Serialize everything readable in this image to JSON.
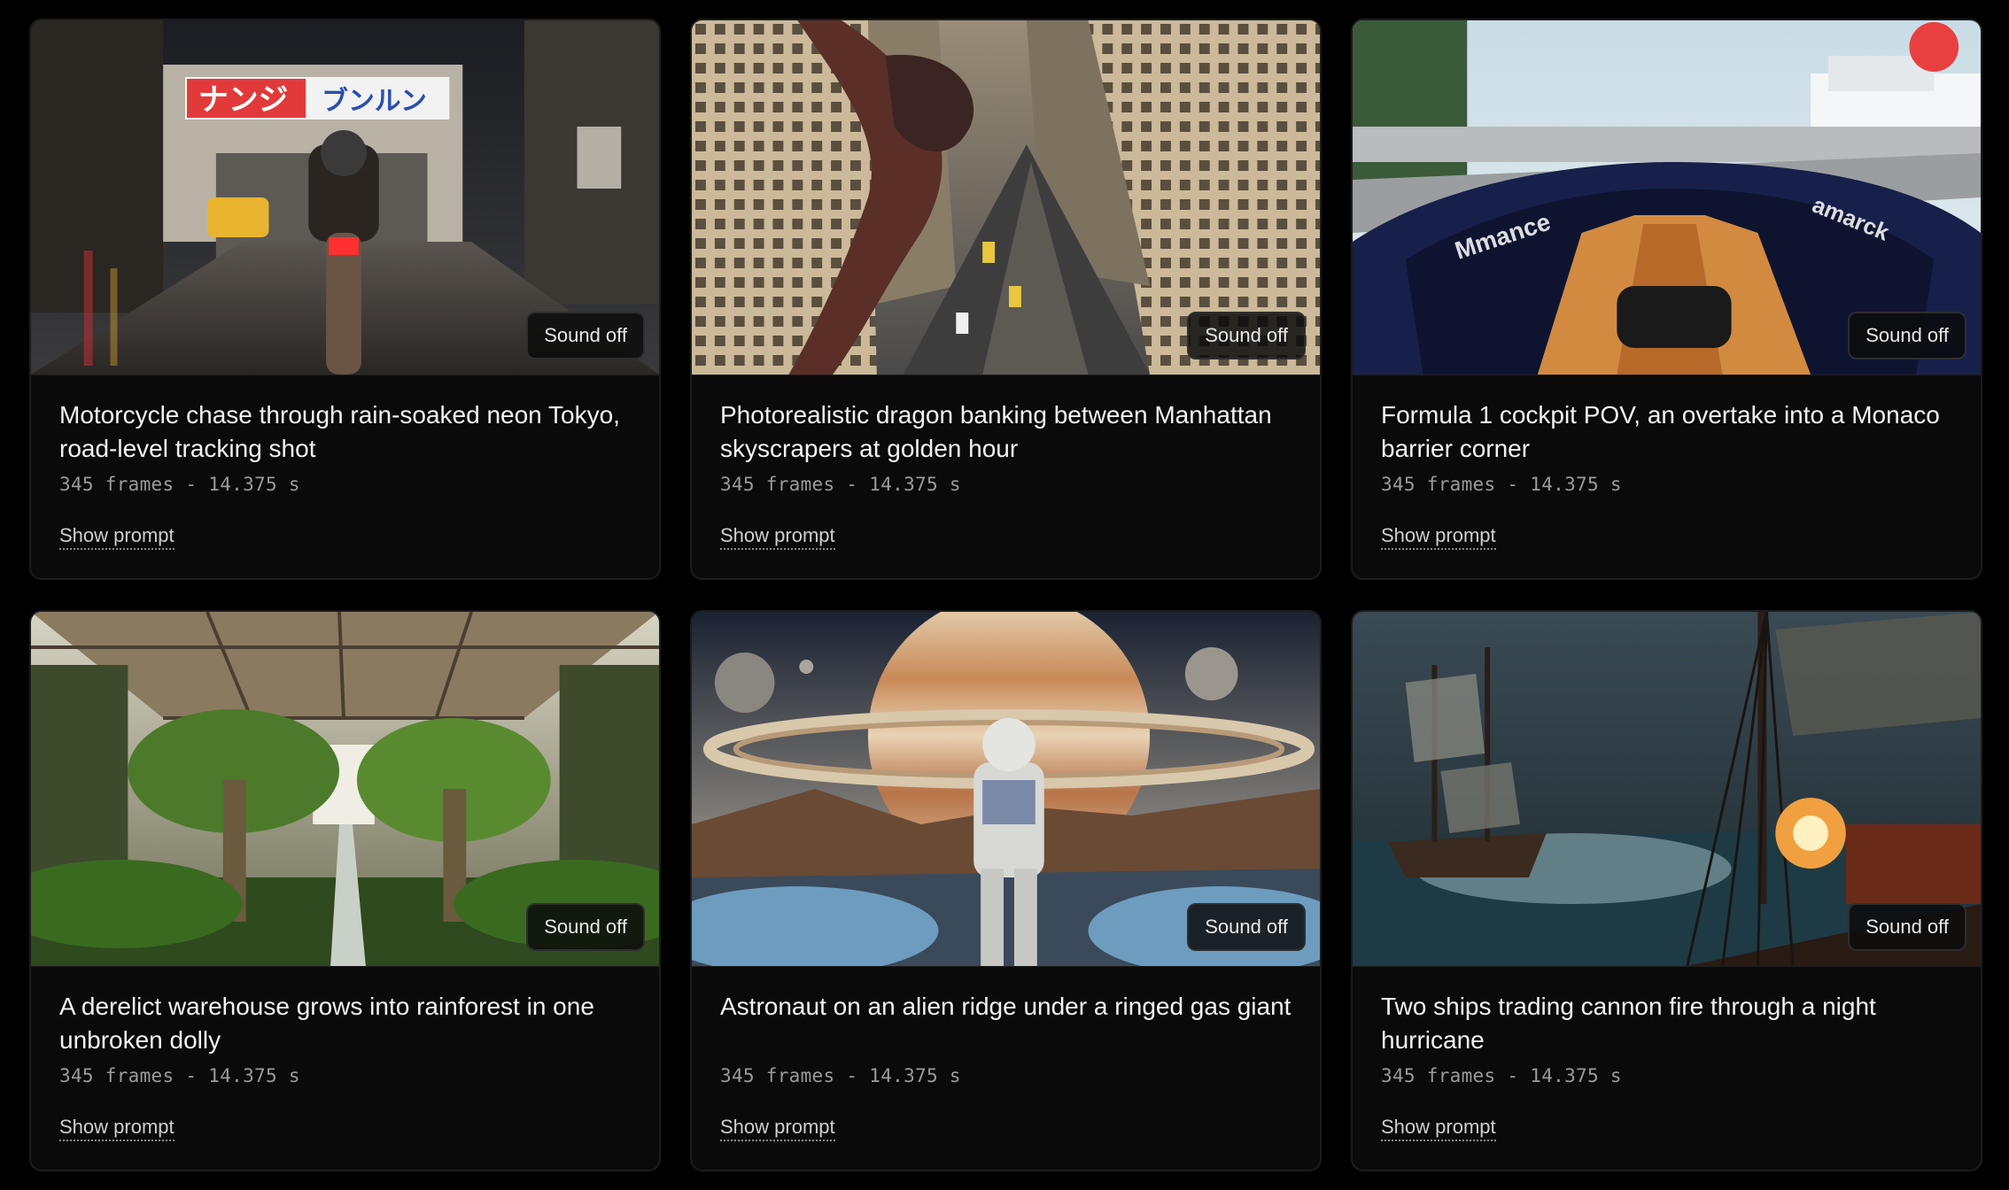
{
  "cards": [
    {
      "title": "Motorcycle chase through rain-soaked neon Tokyo, road-level tracking shot",
      "meta": "345 frames - 14.375 s",
      "sound": "Sound off",
      "show_prompt": "Show prompt",
      "signs": [
        "ナンジ",
        "ブンルン"
      ]
    },
    {
      "title": "Photorealistic dragon banking between Manhattan skyscrapers at golden hour",
      "meta": "345 frames - 14.375 s",
      "sound": "Sound off",
      "show_prompt": "Show prompt"
    },
    {
      "title": "Formula 1 cockpit POV, an overtake into a Monaco barrier corner",
      "meta": "345 frames - 14.375 s",
      "sound": "Sound off",
      "show_prompt": "Show prompt"
    },
    {
      "title": "A derelict warehouse grows into rainforest in one unbroken dolly",
      "meta": "345 frames - 14.375 s",
      "sound": "Sound off",
      "show_prompt": "Show prompt"
    },
    {
      "title": "Astronaut on an alien ridge under a ringed gas giant",
      "meta": "345 frames - 14.375 s",
      "sound": "Sound off",
      "show_prompt": "Show prompt"
    },
    {
      "title": "Two ships trading cannon fire through a night hurricane",
      "meta": "345 frames - 14.375 s",
      "sound": "Sound off",
      "show_prompt": "Show prompt"
    }
  ]
}
